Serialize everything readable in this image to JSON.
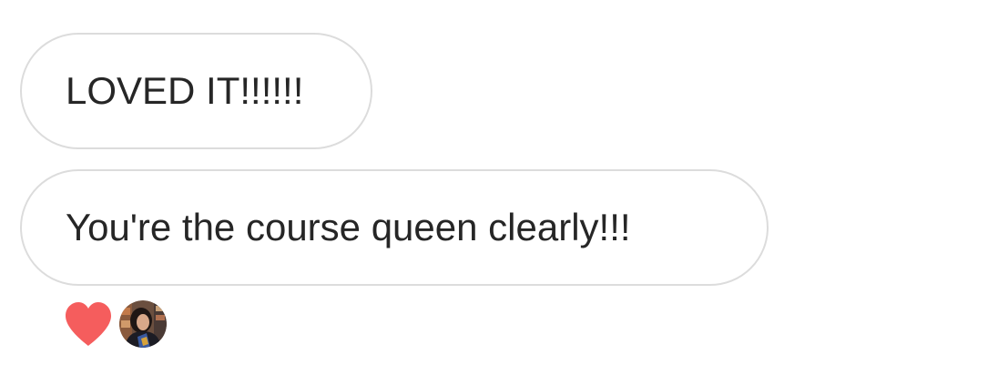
{
  "messages": [
    {
      "text": "LOVED IT!!!!!!"
    },
    {
      "text": "You're the course queen clearly!!!"
    }
  ],
  "reactions": {
    "emoji_icon": "heart-icon",
    "emoji_color": "#f55d5d",
    "avatar": "user-avatar"
  },
  "colors": {
    "bubble_border": "#dcdcdc",
    "text": "#262626",
    "background": "#ffffff"
  }
}
